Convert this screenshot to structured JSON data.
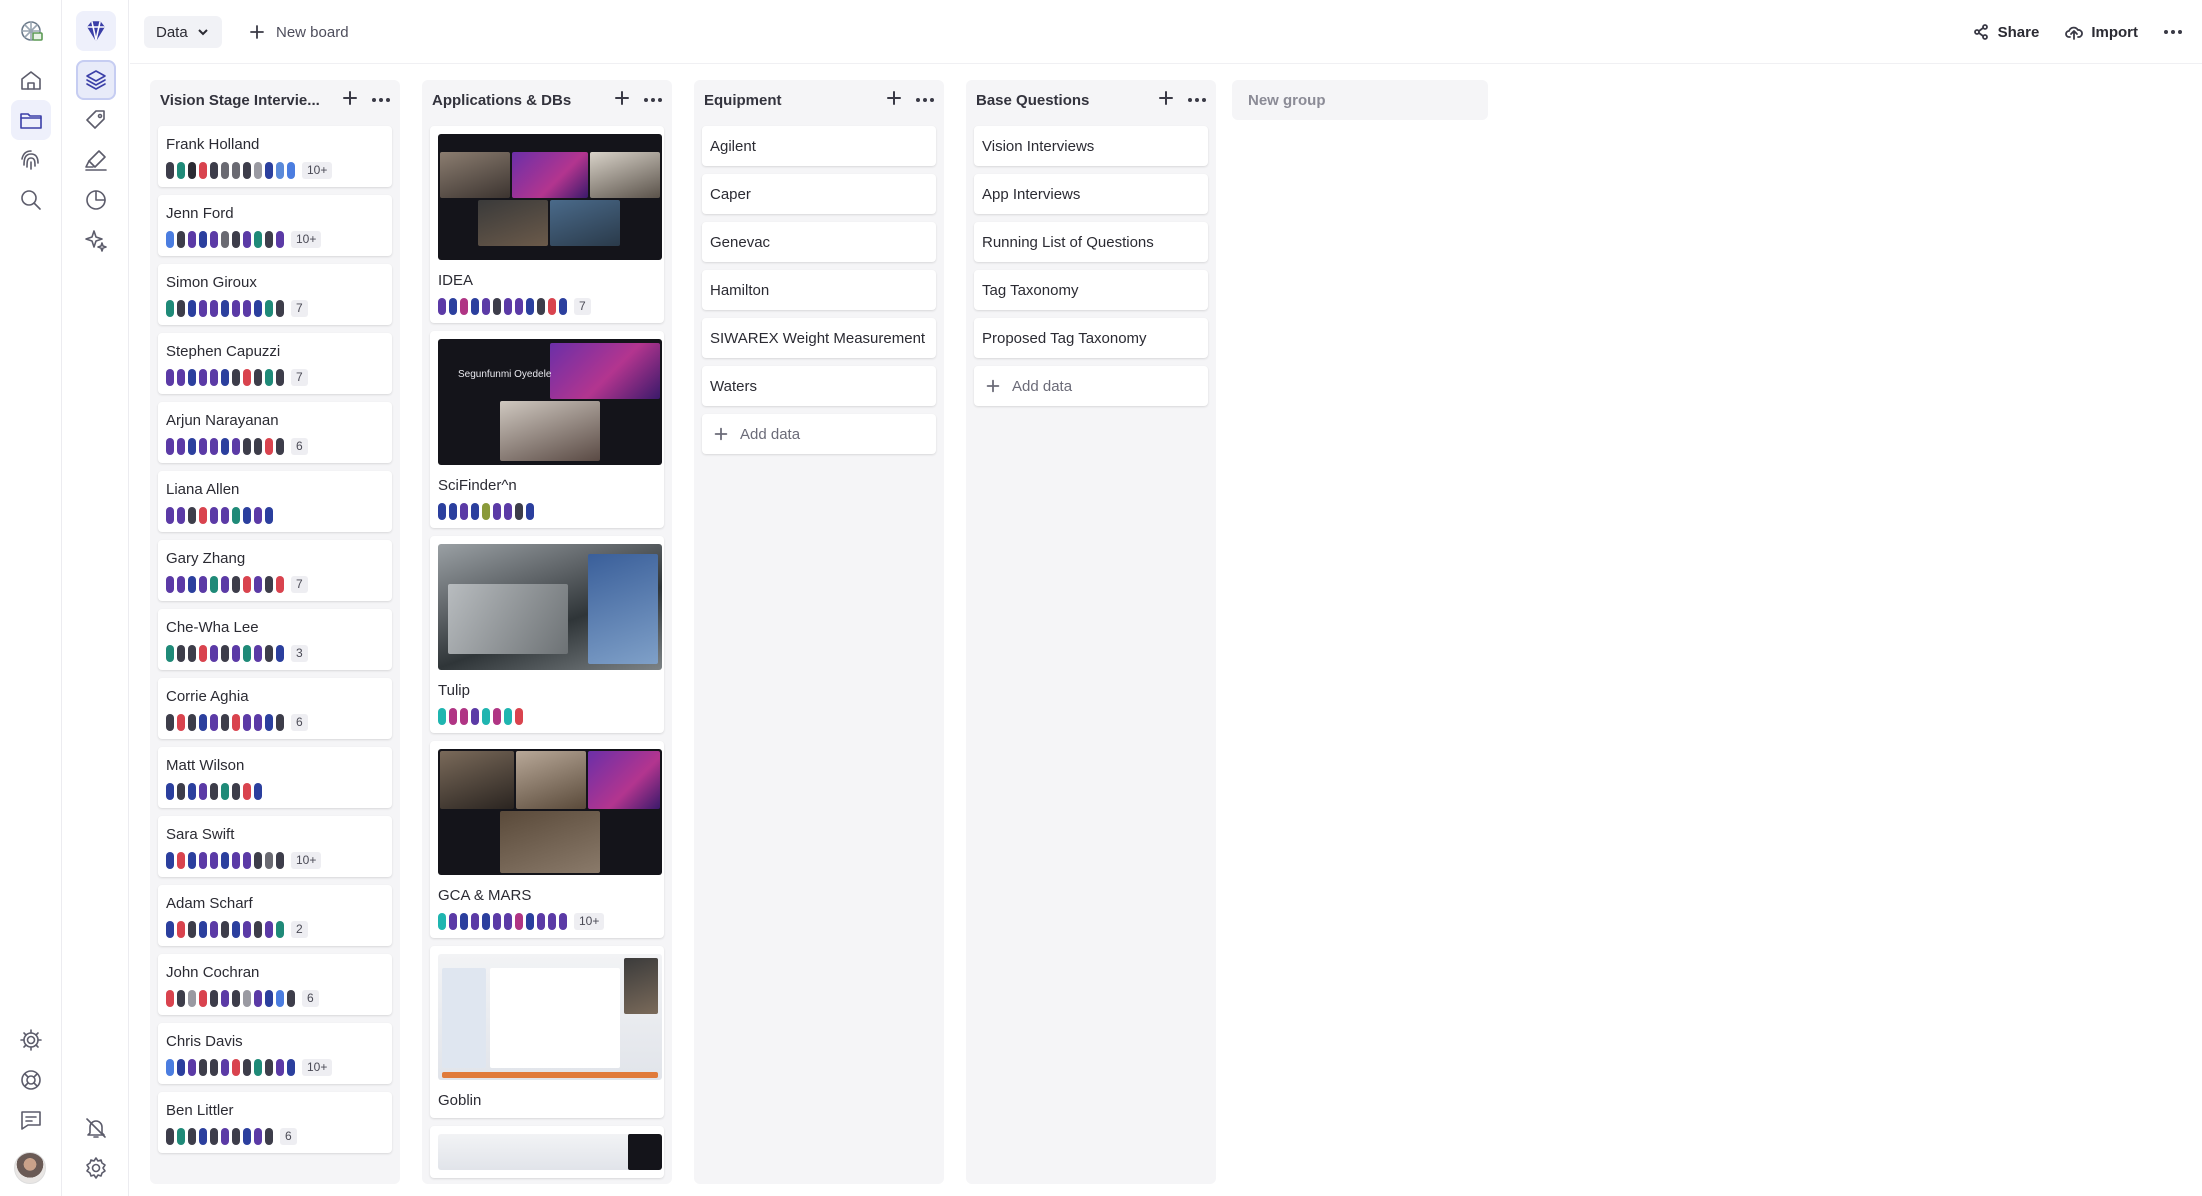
{
  "topbar": {
    "data_button": "Data",
    "new_board": "New board",
    "share": "Share",
    "import": "Import"
  },
  "columns": [
    {
      "title": "Vision Stage Intervie...",
      "cards": [
        {
          "name": "Frank Holland",
          "tags": [
            "#3d3d4a",
            "#1f8a78",
            "#2b2b33",
            "#d9434e",
            "#3d3d4a",
            "#6a6a72",
            "#6a6a72",
            "#3d3d4a",
            "#9a9aa2",
            "#2b3f9e",
            "#5b8ad9",
            "#4b7de0"
          ],
          "count": "10+"
        },
        {
          "name": "Jenn Ford",
          "tags": [
            "#4b7de0",
            "#3d3d4a",
            "#5b3aa6",
            "#2b3f9e",
            "#5b3aa6",
            "#6a6a72",
            "#3d3d4a",
            "#5b3aa6",
            "#1f8a78",
            "#3d3d4a",
            "#5b3aa6"
          ],
          "count": "10+"
        },
        {
          "name": "Simon Giroux",
          "tags": [
            "#1f8a78",
            "#3d3d4a",
            "#2b3f9e",
            "#5b3aa6",
            "#5b3aa6",
            "#2b3f9e",
            "#5b3aa6",
            "#5b3aa6",
            "#2b3f9e",
            "#1f8a78",
            "#3d3d4a"
          ],
          "count": "7"
        },
        {
          "name": "Stephen Capuzzi",
          "tags": [
            "#5b3aa6",
            "#5b3aa6",
            "#2b3f9e",
            "#5b3aa6",
            "#5b3aa6",
            "#2b3f9e",
            "#3d3d4a",
            "#d9434e",
            "#3d3d4a",
            "#1f8a78",
            "#3d3d4a"
          ],
          "count": "7"
        },
        {
          "name": "Arjun Narayanan",
          "tags": [
            "#5b3aa6",
            "#5b3aa6",
            "#2b3f9e",
            "#5b3aa6",
            "#5b3aa6",
            "#2b3f9e",
            "#5b3aa6",
            "#3d3d4a",
            "#3d3d4a",
            "#d9434e",
            "#3d3d4a"
          ],
          "count": "6"
        },
        {
          "name": "Liana Allen",
          "tags": [
            "#5b3aa6",
            "#5b3aa6",
            "#3d3d4a",
            "#d9434e",
            "#5b3aa6",
            "#5b3aa6",
            "#1f8a78",
            "#2b3f9e",
            "#5b3aa6",
            "#2b3f9e"
          ],
          "count": ""
        },
        {
          "name": "Gary Zhang",
          "tags": [
            "#5b3aa6",
            "#5b3aa6",
            "#2b3f9e",
            "#5b3aa6",
            "#1f8a78",
            "#5b3aa6",
            "#3d3d4a",
            "#d9434e",
            "#5b3aa6",
            "#3d3d4a",
            "#d9434e"
          ],
          "count": "7"
        },
        {
          "name": "Che-Wha Lee",
          "tags": [
            "#1f8a78",
            "#3d3d4a",
            "#3d3d4a",
            "#d9434e",
            "#5b3aa6",
            "#3d3d4a",
            "#5b3aa6",
            "#1f8a78",
            "#5b3aa6",
            "#3d3d4a",
            "#2b3f9e"
          ],
          "count": "3"
        },
        {
          "name": "Corrie Aghia",
          "tags": [
            "#3d3d4a",
            "#d9434e",
            "#3d3d4a",
            "#2b3f9e",
            "#5b3aa6",
            "#3d3d4a",
            "#d9434e",
            "#5b3aa6",
            "#5b3aa6",
            "#2b3f9e",
            "#3d3d4a"
          ],
          "count": "6"
        },
        {
          "name": "Matt Wilson",
          "tags": [
            "#2b3f9e",
            "#3d3d4a",
            "#2b3f9e",
            "#5b3aa6",
            "#3d3d4a",
            "#1f8a78",
            "#3d3d4a",
            "#d9434e",
            "#2b3f9e"
          ],
          "count": ""
        },
        {
          "name": "Sara Swift",
          "tags": [
            "#2b3f9e",
            "#d9434e",
            "#2b3f9e",
            "#5b3aa6",
            "#5b3aa6",
            "#2b3f9e",
            "#5b3aa6",
            "#5b3aa6",
            "#3d3d4a",
            "#6a6a72",
            "#3d3d4a"
          ],
          "count": "10+"
        },
        {
          "name": "Adam Scharf",
          "tags": [
            "#2b3f9e",
            "#d9434e",
            "#3d3d4a",
            "#2b3f9e",
            "#5b3aa6",
            "#3d3d4a",
            "#2b3f9e",
            "#5b3aa6",
            "#3d3d4a",
            "#5b3aa6",
            "#1f8a78"
          ],
          "count": "2"
        },
        {
          "name": "John Cochran",
          "tags": [
            "#d9434e",
            "#3d3d4a",
            "#9a9aa2",
            "#d9434e",
            "#3d3d4a",
            "#5b3aa6",
            "#3d3d4a",
            "#9a9aa2",
            "#5b3aa6",
            "#2b3f9e",
            "#4b7de0",
            "#3d3d4a"
          ],
          "count": "6"
        },
        {
          "name": "Chris Davis",
          "tags": [
            "#4b7de0",
            "#2b3f9e",
            "#5b3aa6",
            "#3d3d4a",
            "#3d3d4a",
            "#5b3aa6",
            "#d9434e",
            "#3d3d4a",
            "#1f8a78",
            "#3d3d4a",
            "#5b3aa6",
            "#2b3f9e"
          ],
          "count": "10+"
        },
        {
          "name": "Ben Littler",
          "tags": [
            "#3d3d4a",
            "#1f8a78",
            "#3d3d4a",
            "#2b3f9e",
            "#3d3d4a",
            "#5b3aa6",
            "#3d3d4a",
            "#2b3f9e",
            "#5b3aa6",
            "#3d3d4a"
          ],
          "count": "6"
        }
      ]
    },
    {
      "title": "Applications & DBs",
      "cards": [
        {
          "name": "IDEA",
          "thumb": "meeting",
          "tags": [
            "#5b3aa6",
            "#2b3f9e",
            "#b03584",
            "#2b3f9e",
            "#5b3aa6",
            "#3d3d4a",
            "#5b3aa6",
            "#5b3aa6",
            "#2b3f9e",
            "#3d3d4a",
            "#d9434e",
            "#2b3f9e"
          ],
          "count": "7"
        },
        {
          "name": "SciFinder^n",
          "thumb": "speaker",
          "thumb_label": "Segunfunmi Oyedele",
          "tags": [
            "#2b3f9e",
            "#2b3f9e",
            "#5b3aa6",
            "#2b3f9e",
            "#8a9a3a",
            "#5b3aa6",
            "#5b3aa6",
            "#3d3d4a",
            "#2b3f9e"
          ],
          "count": ""
        },
        {
          "name": "Tulip",
          "thumb": "machine",
          "tags": [
            "#1fb5b0",
            "#b03584",
            "#b03584",
            "#5b3aa6",
            "#1fb5b0",
            "#b03584",
            "#1fb5b0",
            "#d9434e"
          ],
          "count": ""
        },
        {
          "name": "GCA & MARS",
          "thumb": "meeting2",
          "tags": [
            "#1fb5b0",
            "#5b3aa6",
            "#2b3f9e",
            "#5b3aa6",
            "#2b3f9e",
            "#5b3aa6",
            "#5b3aa6",
            "#b03584",
            "#2b3f9e",
            "#5b3aa6",
            "#5b3aa6",
            "#5b3aa6"
          ],
          "count": "10+"
        },
        {
          "name": "Goblin",
          "thumb": "screen",
          "tags": [],
          "count": ""
        },
        {
          "name": "",
          "thumb": "screen2",
          "tags": [],
          "count": ""
        }
      ]
    },
    {
      "title": "Equipment",
      "cards": [
        {
          "name": "Agilent"
        },
        {
          "name": "Caper"
        },
        {
          "name": "Genevac"
        },
        {
          "name": "Hamilton"
        },
        {
          "name": "SIWAREX Weight Measurement"
        },
        {
          "name": "Waters"
        }
      ],
      "add_label": "Add data"
    },
    {
      "title": "Base Questions",
      "cards": [
        {
          "name": "Vision Interviews"
        },
        {
          "name": "App Interviews"
        },
        {
          "name": "Running List of Questions"
        },
        {
          "name": "Tag Taxonomy"
        },
        {
          "name": "Proposed Tag Taxonomy"
        }
      ],
      "add_label": "Add data"
    }
  ],
  "new_group": "New group",
  "icons": {
    "rail1": [
      "logo-icon",
      "home-icon",
      "folder-icon",
      "fingerprint-icon",
      "search-icon",
      "settings-icon",
      "help-icon",
      "chat-icon"
    ],
    "rail2": [
      "project-icon",
      "layers-icon",
      "tag-icon",
      "highlight-icon",
      "chart-icon",
      "sparkle-icon",
      "bell-off-icon",
      "gear-icon"
    ]
  }
}
